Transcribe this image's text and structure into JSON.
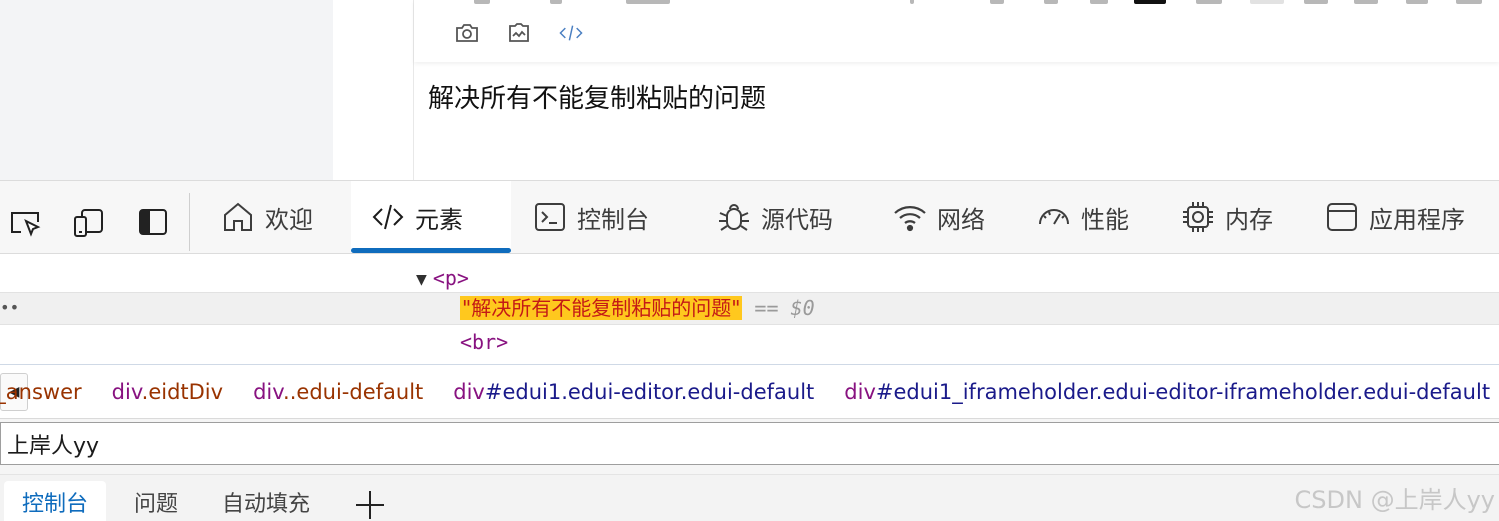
{
  "page": {
    "editor_text": "解决所有不能复制粘贴的问题"
  },
  "editor_toolbar": {
    "icons": [
      "camera-icon",
      "signature-icon",
      "code-icon"
    ]
  },
  "devtools": {
    "left_icons": [
      "inspect-element-icon",
      "device-emulation-icon",
      "dock-side-icon"
    ],
    "tabs": [
      {
        "label": "欢迎",
        "icon": "home-icon"
      },
      {
        "label": "元素",
        "icon": "code-brackets-icon",
        "active": true
      },
      {
        "label": "控制台",
        "icon": "console-icon"
      },
      {
        "label": "源代码",
        "icon": "bug-icon"
      },
      {
        "label": "网络",
        "icon": "wifi-icon"
      },
      {
        "label": "性能",
        "icon": "gauge-icon"
      },
      {
        "label": "内存",
        "icon": "chip-icon"
      },
      {
        "label": "应用程序",
        "icon": "app-window-icon"
      }
    ]
  },
  "dom_tree": {
    "p_tag": "<p>",
    "text_node": "\"解决所有不能复制粘贴的问题\"",
    "selected_marker": "== $0",
    "br_tag": "<br>",
    "row_menu": "••"
  },
  "breadcrumb": {
    "scroll_left": "◀",
    "items": [
      {
        "tag": "",
        "rest": "",
        "cls": "n_answer"
      },
      {
        "tag": "div",
        "rest": "",
        "cls": ".eidtDiv"
      },
      {
        "tag": "div",
        "rest": "",
        "cls": "..edui-default"
      },
      {
        "tag": "div",
        "rest": "#edui1.edui-editor.edui-default",
        "cls": ""
      },
      {
        "tag": "div",
        "rest": "#edui1_iframeholder.edui-editor-iframeholder.edui-default",
        "cls": ""
      }
    ]
  },
  "search": {
    "value": "上岸人yy"
  },
  "drawer": {
    "tabs": [
      {
        "label": "控制台",
        "active": true
      },
      {
        "label": "问题"
      },
      {
        "label": "自动填充"
      }
    ],
    "add_label": "+"
  },
  "watermark": "CSDN @上岸人yy"
}
